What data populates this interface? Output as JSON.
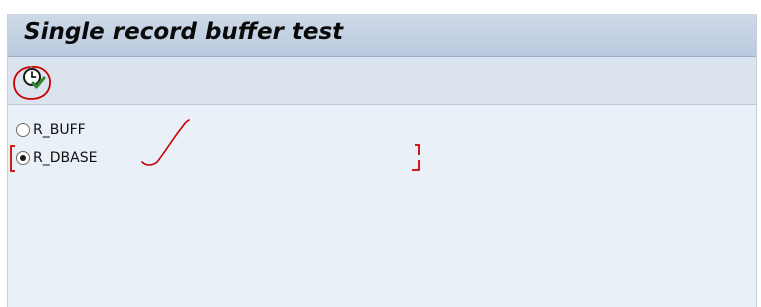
{
  "screen": {
    "title": "Single record buffer test"
  },
  "toolbar": {
    "execute_icon": "execute-clock-icon"
  },
  "selection": {
    "options": [
      {
        "label": "R_BUFF",
        "selected": false
      },
      {
        "label": "R_DBASE",
        "selected": true
      }
    ]
  },
  "colors": {
    "annotation": "#cc0000",
    "title_bar": "#c4d2e3",
    "background": "#eaf0f8"
  }
}
